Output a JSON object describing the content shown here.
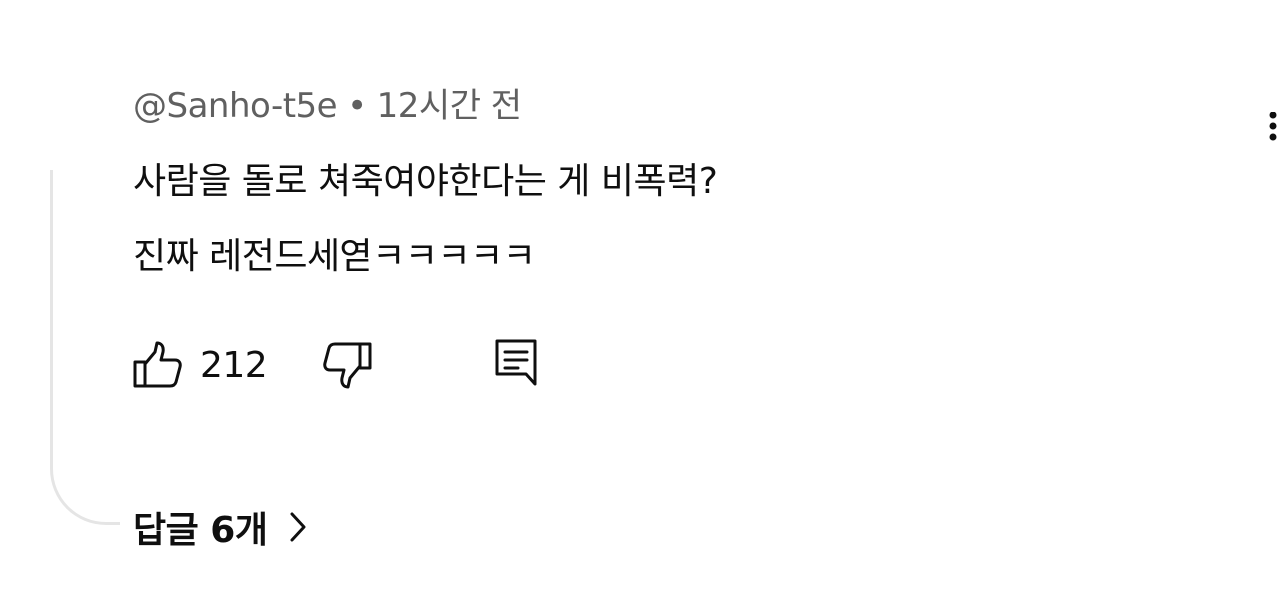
{
  "comment": {
    "author": "@Sanho-t5e",
    "separator": "•",
    "time": "12시간 전",
    "text_lines": [
      "사람을 돌로 쳐죽여야한다는 게 비폭력?",
      "진짜 레전드세엳ㅋㅋㅋㅋㅋ"
    ]
  },
  "actions": {
    "like_count": "212"
  },
  "replies": {
    "label": "답글 6개"
  },
  "icons": {
    "more": "more-vert-icon",
    "like": "thumb-up-icon",
    "dislike": "thumb-down-icon",
    "reply": "reply-comment-icon",
    "chevron": "chevron-right-icon"
  },
  "colors": {
    "text": "#0f0f0f",
    "meta": "#606060",
    "thread_line": "#e5e5e5"
  }
}
